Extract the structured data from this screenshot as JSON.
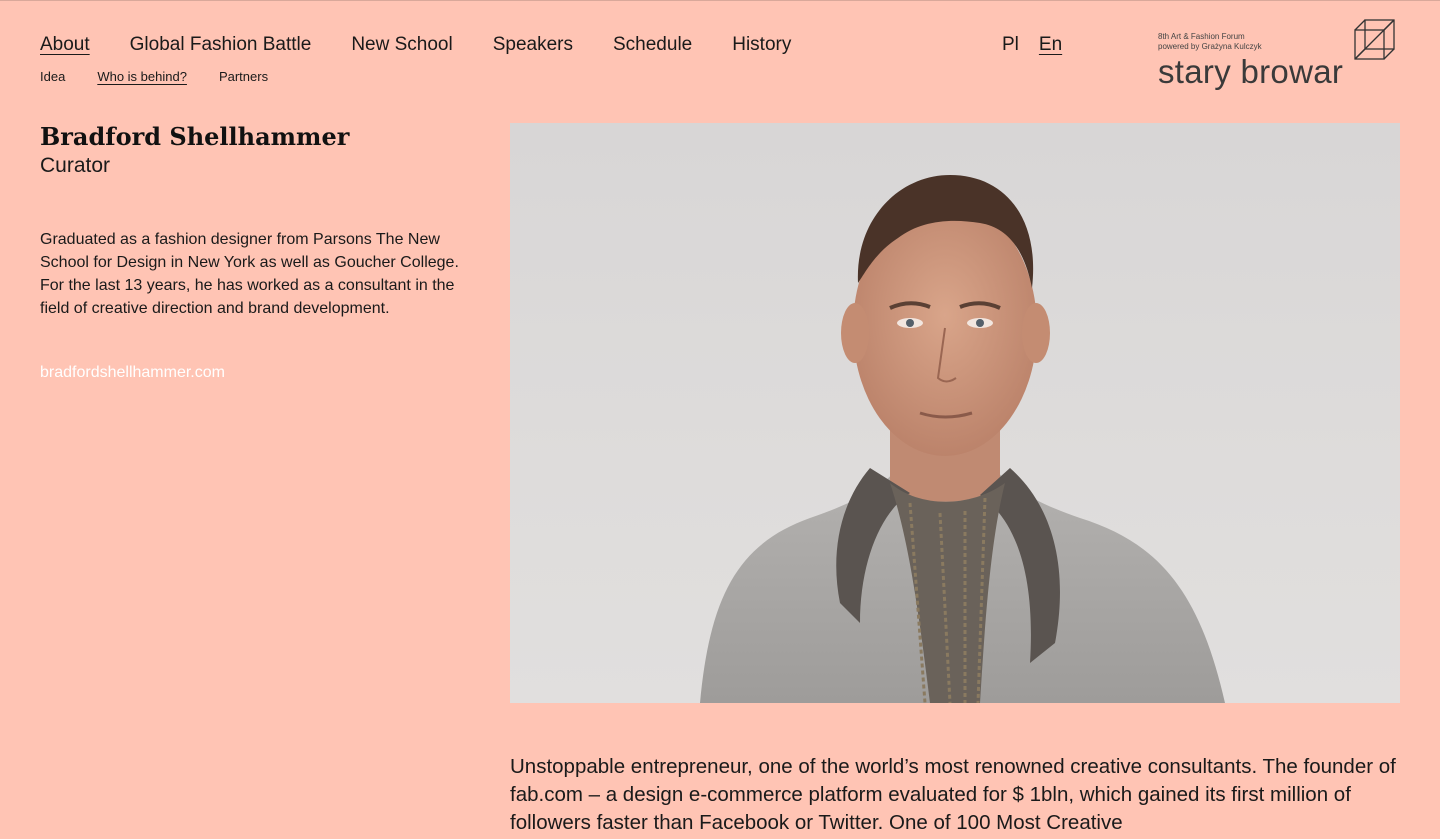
{
  "nav": {
    "items": [
      {
        "label": "About",
        "active": true
      },
      {
        "label": "Global Fashion Battle"
      },
      {
        "label": "New School"
      },
      {
        "label": "Speakers"
      },
      {
        "label": "Schedule"
      },
      {
        "label": "History"
      }
    ]
  },
  "subnav": {
    "items": [
      {
        "label": "Idea"
      },
      {
        "label": "Who is behind?",
        "active": true
      },
      {
        "label": "Partners"
      }
    ]
  },
  "lang": {
    "pl": "Pl",
    "en": "En",
    "active": "En"
  },
  "logo": {
    "line1": "8th Art & Fashion Forum",
    "line2": "powered by Grażyna Kulczyk",
    "brand": "stary browar"
  },
  "person": {
    "name": "Bradford Shellhammer",
    "role": "Curator",
    "bio": "Graduated as a fashion designer from Parsons The New School for Design in New York as well as Goucher College. For the last 13 years, he has worked as a consultant in the field of creative direction and brand development.",
    "website": "bradfordshellhammer.com",
    "description": "Unstoppable entrepreneur, one of the world’s most renowned creative consultants. The founder of fab.com – a design e-commerce platform evaluated for $ 1bln, which gained its first million of followers faster than Facebook or Twitter. One of 100 Most Creative"
  },
  "colors": {
    "background": "#ffc4b4",
    "link": "#ffffff",
    "text": "#1a1a1a"
  }
}
